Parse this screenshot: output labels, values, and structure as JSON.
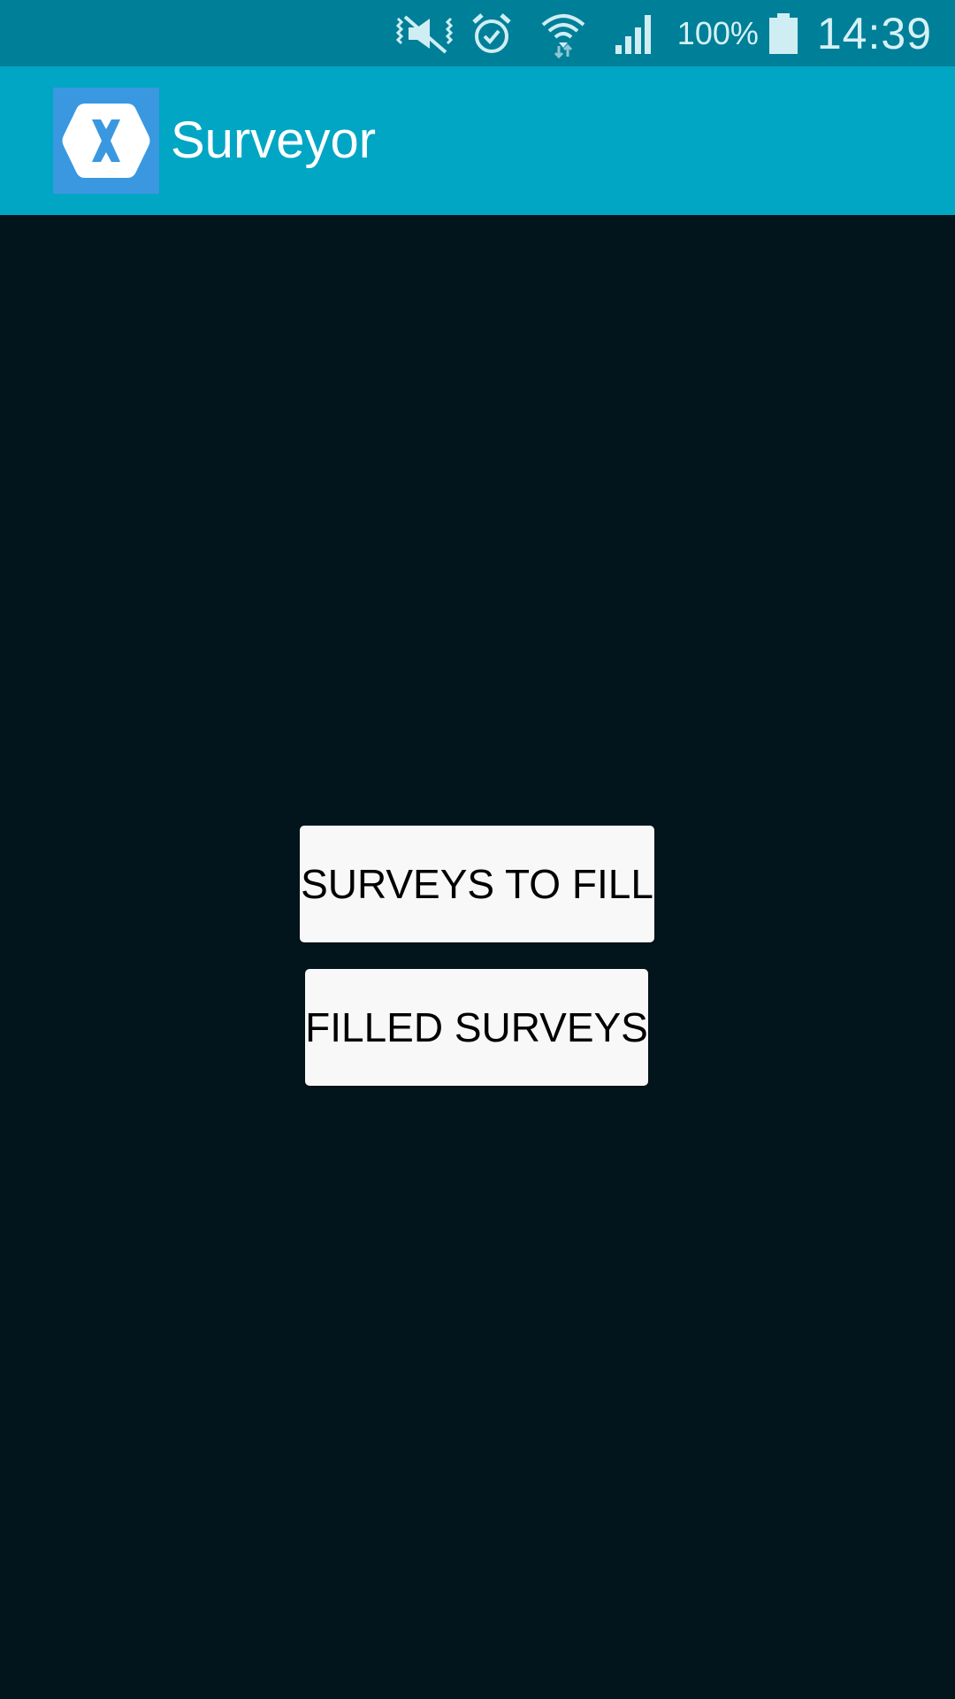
{
  "status_bar": {
    "icons": [
      "vibrate-mute-icon",
      "alarm-icon",
      "wifi-icon",
      "signal-icon",
      "battery-icon"
    ],
    "battery_percent": "100%",
    "time": "14:39"
  },
  "app_bar": {
    "title": "Surveyor",
    "logo_icon": "xamarin-logo-icon"
  },
  "main": {
    "buttons": [
      {
        "label": "SURVEYS TO FILL"
      },
      {
        "label": "FILLED SURVEYS"
      }
    ]
  },
  "colors": {
    "status_bar": "#007f99",
    "app_bar": "#00a6c4",
    "background": "#02141c",
    "logo_bg": "#3a98e0",
    "button_bg": "#f8f8f8"
  }
}
